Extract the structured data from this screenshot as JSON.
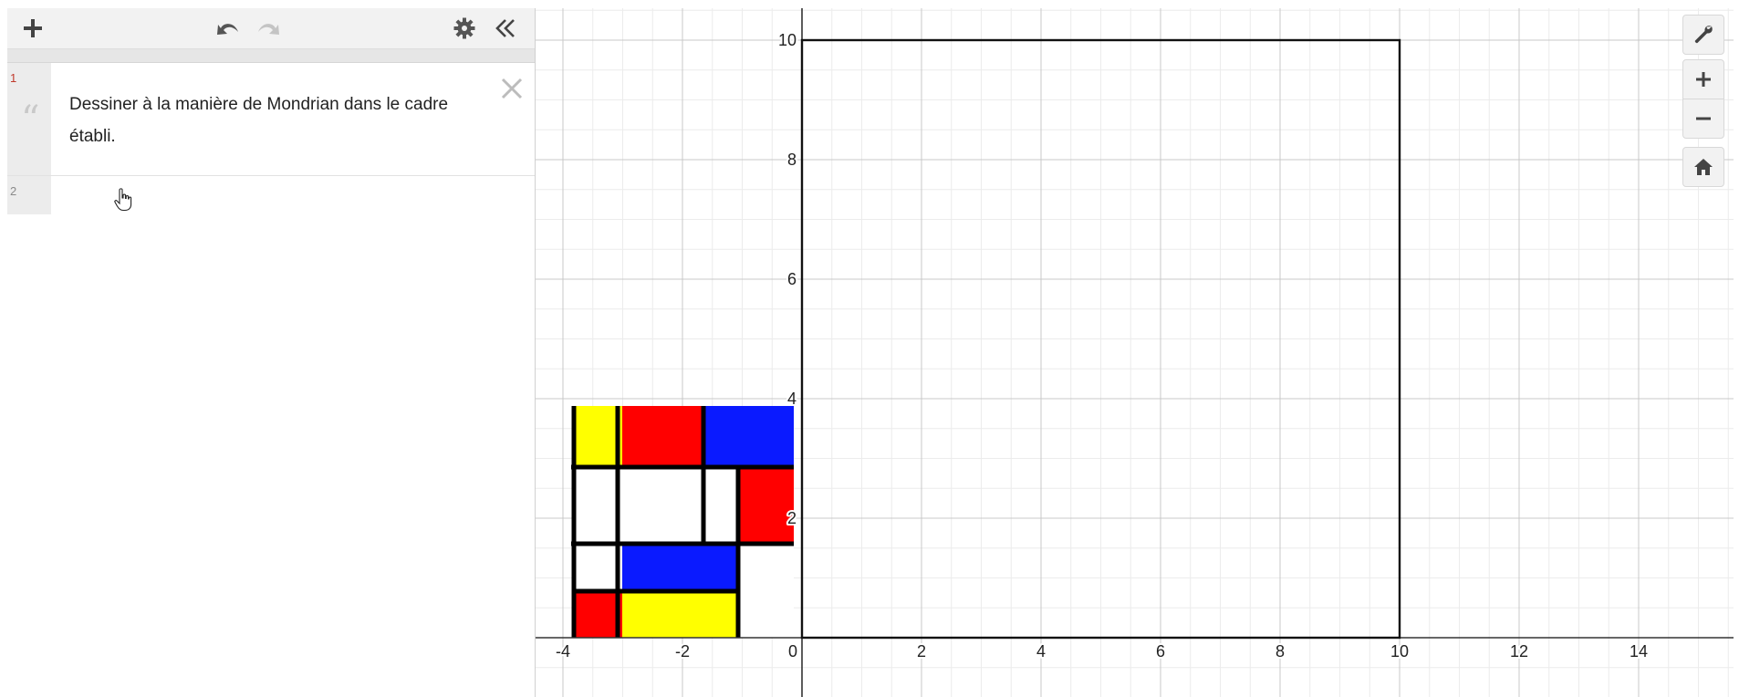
{
  "toolbar": {
    "add_icon": "plus-icon",
    "undo_icon": "undo-icon",
    "redo_icon": "redo-icon",
    "settings_icon": "gear-icon",
    "collapse_icon": "double-chevron-left-icon"
  },
  "expressions": [
    {
      "index": "1",
      "type": "note",
      "text": "Dessiner à la manière de Mondrian dans le cadre établi."
    },
    {
      "index": "2",
      "type": "empty",
      "text": ""
    }
  ],
  "graph": {
    "x_ticks": [
      "-4",
      "-2",
      "0",
      "2",
      "4",
      "6",
      "8",
      "10",
      "12",
      "14"
    ],
    "y_ticks": [
      "2",
      "4",
      "6",
      "8",
      "10"
    ],
    "frame": {
      "x": [
        0,
        10
      ],
      "y": [
        0,
        10
      ]
    },
    "colors": {
      "yellow": "#ffff00",
      "red": "#ff0000",
      "blue": "#0a1aff",
      "line": "#000000"
    }
  },
  "side_tools": [
    {
      "name": "graph-settings-button",
      "icon": "wrench-icon"
    },
    {
      "name": "zoom-in-button",
      "icon": "plus-icon"
    },
    {
      "name": "zoom-out-button",
      "icon": "minus-icon"
    },
    {
      "name": "default-viewport-button",
      "icon": "home-icon"
    }
  ]
}
